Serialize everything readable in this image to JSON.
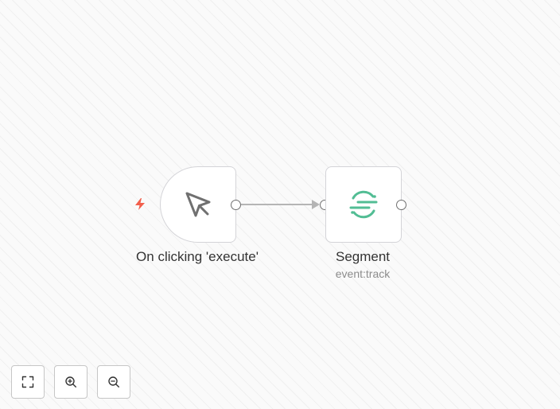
{
  "nodes": {
    "trigger": {
      "label": "On clicking 'execute'",
      "icon": "cursor-icon"
    },
    "segment": {
      "label": "Segment",
      "subtitle": "event:track",
      "icon": "segment-logo"
    }
  },
  "colors": {
    "trigger_bolt": "#f25f4c",
    "segment_green": "#52bd94",
    "connector": "#b5b5b5",
    "handle_border": "#707070"
  },
  "controls": [
    {
      "name": "fit-view",
      "icon": "fullscreen-icon"
    },
    {
      "name": "zoom-in",
      "icon": "zoom-in-icon"
    },
    {
      "name": "zoom-out",
      "icon": "zoom-out-icon"
    }
  ]
}
